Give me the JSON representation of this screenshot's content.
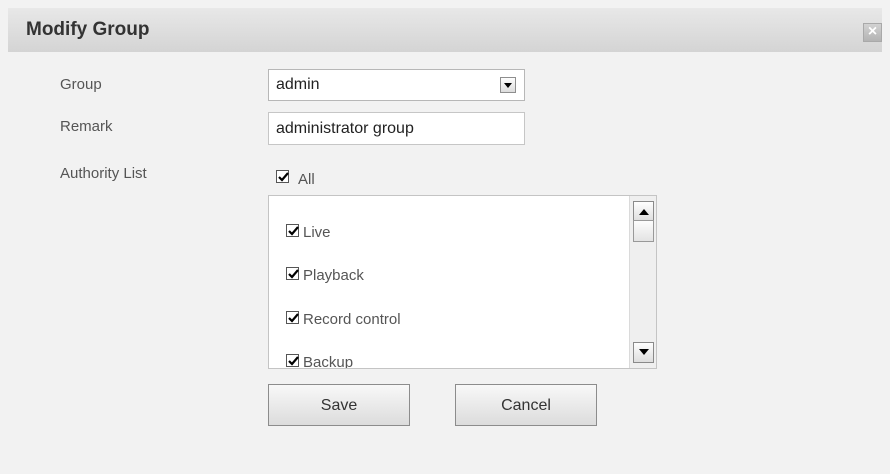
{
  "dialog": {
    "title": "Modify Group",
    "close_icon": "close-icon",
    "close_glyph": "×"
  },
  "form": {
    "group_label": "Group",
    "group_value": "admin",
    "remark_label": "Remark",
    "remark_value": "administrator group",
    "authority_label": "Authority List",
    "all_label": "All",
    "all_checked": true
  },
  "authority_list": {
    "items": [
      {
        "label": "Live",
        "checked": true
      },
      {
        "label": "Playback",
        "checked": true
      },
      {
        "label": "Record control",
        "checked": true
      },
      {
        "label": "Backup",
        "checked": true
      }
    ]
  },
  "buttons": {
    "save_label": "Save",
    "cancel_label": "Cancel"
  },
  "colors": {
    "background": "#f2f2f2",
    "titlebar": "#dcdcdc",
    "text": "#555555"
  }
}
